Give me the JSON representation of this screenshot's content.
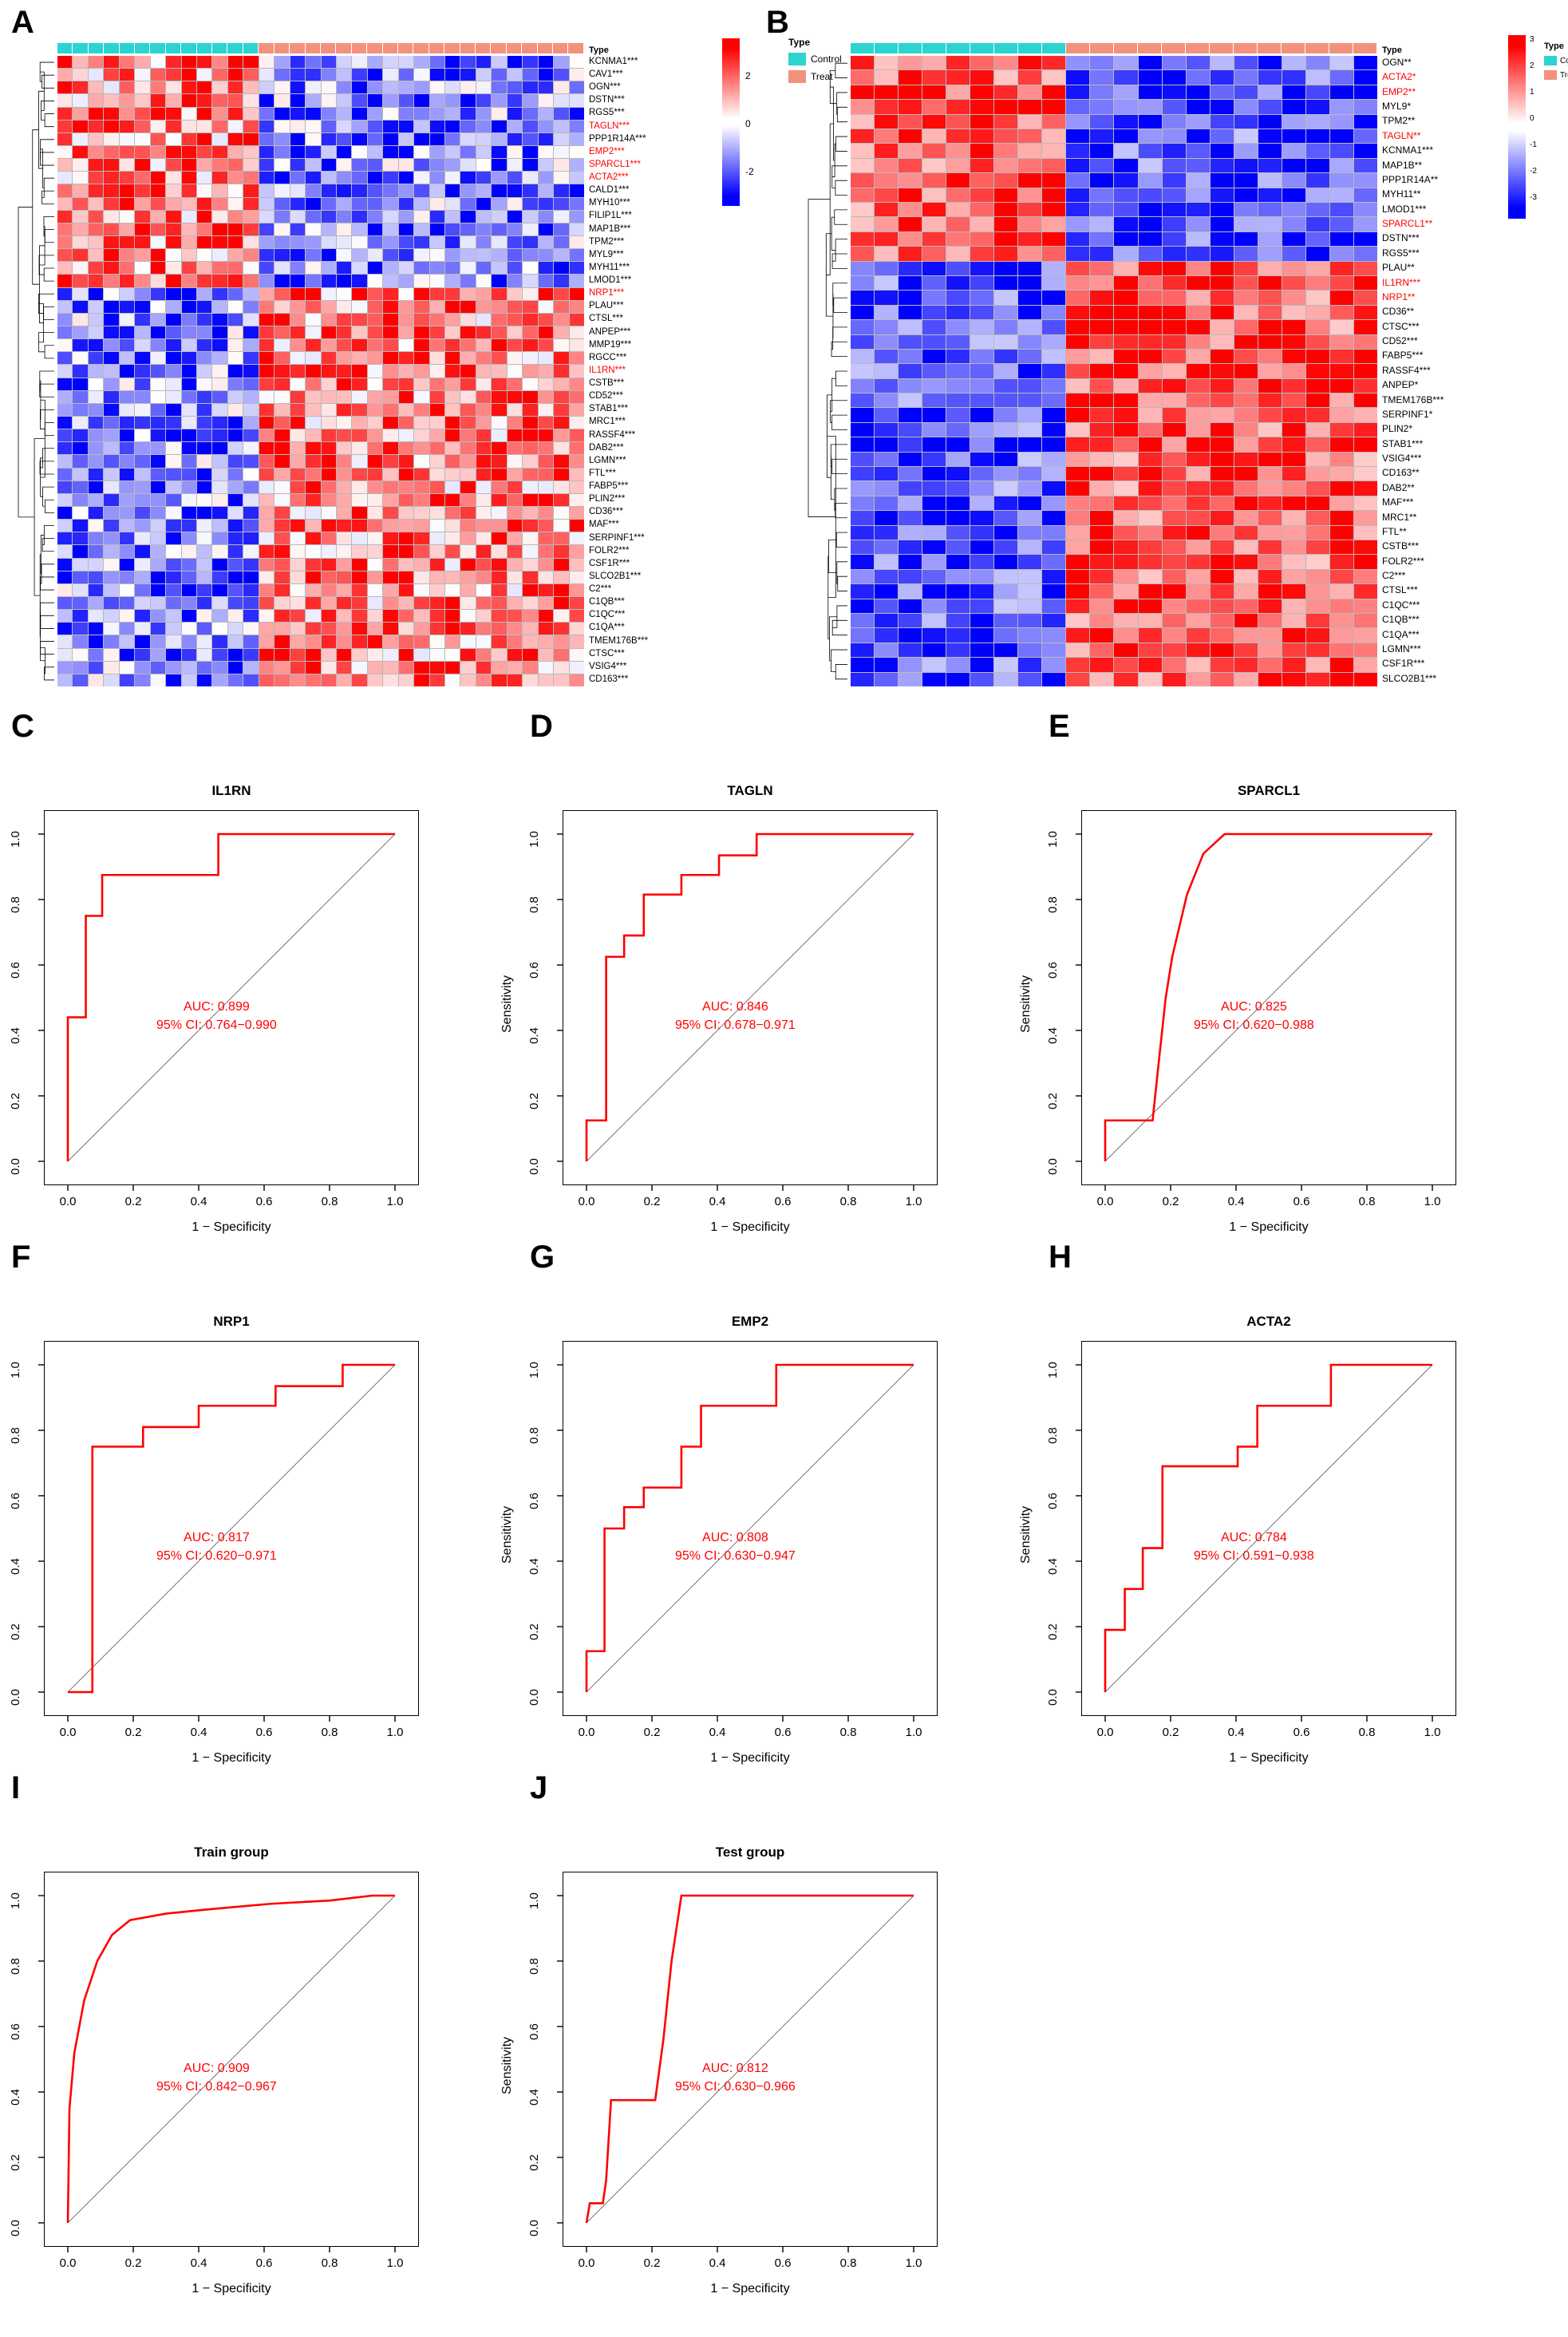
{
  "figure": {
    "panels": [
      "A",
      "B",
      "C",
      "D",
      "E",
      "F",
      "G",
      "H",
      "I",
      "J"
    ]
  },
  "heatmap_legend": {
    "type_title": "Type",
    "groups": [
      {
        "label": "Control",
        "color": "#2BD4CE"
      },
      {
        "label": "Treat",
        "color": "#F2917E"
      }
    ]
  },
  "panelA": {
    "letter": "A",
    "colorbar_ticks": [
      "2",
      "0",
      "-2"
    ],
    "annotation_title": "Type",
    "n_control": 13,
    "n_treat": 21,
    "genes": [
      {
        "label": "KCNMA1***",
        "color": "black"
      },
      {
        "label": "CAV1***",
        "color": "black"
      },
      {
        "label": "OGN***",
        "color": "black"
      },
      {
        "label": "DSTN***",
        "color": "black"
      },
      {
        "label": "RGS5***",
        "color": "black"
      },
      {
        "label": "TAGLN***",
        "color": "red"
      },
      {
        "label": "PPP1R14A***",
        "color": "black"
      },
      {
        "label": "EMP2***",
        "color": "red"
      },
      {
        "label": "SPARCL1***",
        "color": "red"
      },
      {
        "label": "ACTA2***",
        "color": "red"
      },
      {
        "label": "CALD1***",
        "color": "black"
      },
      {
        "label": "MYH10***",
        "color": "black"
      },
      {
        "label": "FILIP1L***",
        "color": "black"
      },
      {
        "label": "MAP1B***",
        "color": "black"
      },
      {
        "label": "TPM2***",
        "color": "black"
      },
      {
        "label": "MYL9***",
        "color": "black"
      },
      {
        "label": "MYH11***",
        "color": "black"
      },
      {
        "label": "LMOD1***",
        "color": "black"
      },
      {
        "label": "NRP1***",
        "color": "red"
      },
      {
        "label": "PLAU***",
        "color": "black"
      },
      {
        "label": "CTSL***",
        "color": "black"
      },
      {
        "label": "ANPEP***",
        "color": "black"
      },
      {
        "label": "MMP19***",
        "color": "black"
      },
      {
        "label": "RGCC***",
        "color": "black"
      },
      {
        "label": "IL1RN***",
        "color": "red"
      },
      {
        "label": "CSTB***",
        "color": "black"
      },
      {
        "label": "CD52***",
        "color": "black"
      },
      {
        "label": "STAB1***",
        "color": "black"
      },
      {
        "label": "MRC1***",
        "color": "black"
      },
      {
        "label": "RASSF4***",
        "color": "black"
      },
      {
        "label": "DAB2***",
        "color": "black"
      },
      {
        "label": "LGMN***",
        "color": "black"
      },
      {
        "label": "FTL***",
        "color": "black"
      },
      {
        "label": "FABP5***",
        "color": "black"
      },
      {
        "label": "PLIN2***",
        "color": "black"
      },
      {
        "label": "CD36***",
        "color": "black"
      },
      {
        "label": "MAF***",
        "color": "black"
      },
      {
        "label": "SERPINF1***",
        "color": "black"
      },
      {
        "label": "FOLR2***",
        "color": "black"
      },
      {
        "label": "CSF1R***",
        "color": "black"
      },
      {
        "label": "SLCO2B1***",
        "color": "black"
      },
      {
        "label": "C2***",
        "color": "black"
      },
      {
        "label": "C1QB***",
        "color": "black"
      },
      {
        "label": "C1QC***",
        "color": "black"
      },
      {
        "label": "C1QA***",
        "color": "black"
      },
      {
        "label": "TMEM176B***",
        "color": "black"
      },
      {
        "label": "CTSC***",
        "color": "black"
      },
      {
        "label": "VSIG4***",
        "color": "black"
      },
      {
        "label": "CD163***",
        "color": "black"
      }
    ]
  },
  "panelB": {
    "letter": "B",
    "colorbar_ticks": [
      "3",
      "2",
      "1",
      "0",
      "-1",
      "-2",
      "-3"
    ],
    "annotation_title": "Type",
    "n_control": 9,
    "n_treat": 13,
    "genes": [
      {
        "label": "OGN**",
        "color": "black"
      },
      {
        "label": "ACTA2*",
        "color": "red"
      },
      {
        "label": "EMP2**",
        "color": "red"
      },
      {
        "label": "MYL9*",
        "color": "black"
      },
      {
        "label": "TPM2**",
        "color": "black"
      },
      {
        "label": "TAGLN**",
        "color": "red"
      },
      {
        "label": "KCNMA1***",
        "color": "black"
      },
      {
        "label": "MAP1B**",
        "color": "black"
      },
      {
        "label": "PPP1R14A**",
        "color": "black"
      },
      {
        "label": "MYH11**",
        "color": "black"
      },
      {
        "label": "LMOD1***",
        "color": "black"
      },
      {
        "label": "SPARCL1**",
        "color": "red"
      },
      {
        "label": "DSTN***",
        "color": "black"
      },
      {
        "label": "RGS5***",
        "color": "black"
      },
      {
        "label": "PLAU**",
        "color": "black"
      },
      {
        "label": "IL1RN***",
        "color": "red"
      },
      {
        "label": "NRP1**",
        "color": "red"
      },
      {
        "label": "CD36**",
        "color": "black"
      },
      {
        "label": "CTSC***",
        "color": "black"
      },
      {
        "label": "CD52***",
        "color": "black"
      },
      {
        "label": "FABP5***",
        "color": "black"
      },
      {
        "label": "RASSF4***",
        "color": "black"
      },
      {
        "label": "ANPEP*",
        "color": "black"
      },
      {
        "label": "TMEM176B***",
        "color": "black"
      },
      {
        "label": "SERPINF1*",
        "color": "black"
      },
      {
        "label": "PLIN2*",
        "color": "black"
      },
      {
        "label": "STAB1***",
        "color": "black"
      },
      {
        "label": "VSIG4***",
        "color": "black"
      },
      {
        "label": "CD163**",
        "color": "black"
      },
      {
        "label": "DAB2**",
        "color": "black"
      },
      {
        "label": "MAF***",
        "color": "black"
      },
      {
        "label": "MRC1**",
        "color": "black"
      },
      {
        "label": "FTL**",
        "color": "black"
      },
      {
        "label": "CSTB***",
        "color": "black"
      },
      {
        "label": "FOLR2***",
        "color": "black"
      },
      {
        "label": "C2***",
        "color": "black"
      },
      {
        "label": "CTSL***",
        "color": "black"
      },
      {
        "label": "C1QC***",
        "color": "black"
      },
      {
        "label": "C1QB***",
        "color": "black"
      },
      {
        "label": "C1QA***",
        "color": "black"
      },
      {
        "label": "LGMN***",
        "color": "black"
      },
      {
        "label": "CSF1R***",
        "color": "black"
      },
      {
        "label": "SLCO2B1***",
        "color": "black"
      }
    ]
  },
  "roc_axis": {
    "xlabel": "1 − Specificity",
    "ylabel": "Sensitivity",
    "ticks": [
      "0.0",
      "0.2",
      "0.4",
      "0.6",
      "0.8",
      "1.0"
    ],
    "curve_color": "#FF0000",
    "diagonal_color": "#777777"
  },
  "chart_data": [
    {
      "panel": "C",
      "type": "line",
      "title": "IL1RN",
      "auc_label": "AUC: 0.899",
      "ci_label": "95% CI: 0.764−0.990",
      "auc": 0.899,
      "ci": [
        0.764,
        0.99
      ],
      "xlabel": "1 − Specificity",
      "ylabel": "Sensitivity",
      "xlim": [
        0,
        1
      ],
      "ylim": [
        0,
        1
      ],
      "grid": false,
      "points": [
        [
          0,
          0
        ],
        [
          0,
          0.44
        ],
        [
          0.055,
          0.44
        ],
        [
          0.055,
          0.75
        ],
        [
          0.105,
          0.75
        ],
        [
          0.105,
          0.875
        ],
        [
          0.46,
          0.875
        ],
        [
          0.46,
          1.0
        ],
        [
          1,
          1
        ]
      ]
    },
    {
      "panel": "D",
      "type": "line",
      "title": "TAGLN",
      "auc_label": "AUC: 0.846",
      "ci_label": "95% CI: 0.678−0.971",
      "auc": 0.846,
      "ci": [
        0.678,
        0.971
      ],
      "xlabel": "1 − Specificity",
      "ylabel": "Sensitivity",
      "xlim": [
        0,
        1
      ],
      "ylim": [
        0,
        1
      ],
      "grid": false,
      "points": [
        [
          0,
          0
        ],
        [
          0,
          0.125
        ],
        [
          0.06,
          0.125
        ],
        [
          0.06,
          0.625
        ],
        [
          0.115,
          0.625
        ],
        [
          0.115,
          0.69
        ],
        [
          0.175,
          0.69
        ],
        [
          0.175,
          0.815
        ],
        [
          0.29,
          0.815
        ],
        [
          0.29,
          0.875
        ],
        [
          0.405,
          0.875
        ],
        [
          0.405,
          0.935
        ],
        [
          0.52,
          0.935
        ],
        [
          0.52,
          1.0
        ],
        [
          1,
          1
        ]
      ]
    },
    {
      "panel": "E",
      "type": "line",
      "title": "SPARCL1",
      "auc_label": "AUC: 0.825",
      "ci_label": "95% CI: 0.620−0.988",
      "auc": 0.825,
      "ci": [
        0.62,
        0.988
      ],
      "xlabel": "1 − Specificity",
      "ylabel": "Sensitivity",
      "xlim": [
        0,
        1
      ],
      "ylim": [
        0,
        1
      ],
      "grid": false,
      "points": [
        [
          0,
          0
        ],
        [
          0,
          0.125
        ],
        [
          0.145,
          0.125
        ],
        [
          0.165,
          0.315
        ],
        [
          0.185,
          0.5
        ],
        [
          0.205,
          0.625
        ],
        [
          0.25,
          0.815
        ],
        [
          0.3,
          0.94
        ],
        [
          0.365,
          1.0
        ],
        [
          1,
          1
        ]
      ]
    },
    {
      "panel": "F",
      "type": "line",
      "title": "NRP1",
      "auc_label": "AUC: 0.817",
      "ci_label": "95% CI: 0.620−0.971",
      "auc": 0.817,
      "ci": [
        0.62,
        0.971
      ],
      "xlabel": "1 − Specificity",
      "ylabel": "Sensitivity",
      "xlim": [
        0,
        1
      ],
      "ylim": [
        0,
        1
      ],
      "grid": false,
      "points": [
        [
          0,
          0
        ],
        [
          0.075,
          0
        ],
        [
          0.075,
          0.75
        ],
        [
          0.23,
          0.75
        ],
        [
          0.23,
          0.81
        ],
        [
          0.4,
          0.81
        ],
        [
          0.4,
          0.875
        ],
        [
          0.635,
          0.875
        ],
        [
          0.635,
          0.935
        ],
        [
          0.84,
          0.935
        ],
        [
          0.84,
          1.0
        ],
        [
          1,
          1
        ]
      ]
    },
    {
      "panel": "G",
      "type": "line",
      "title": "EMP2",
      "auc_label": "AUC: 0.808",
      "ci_label": "95% CI: 0.630−0.947",
      "auc": 0.808,
      "ci": [
        0.63,
        0.947
      ],
      "xlabel": "1 − Specificity",
      "ylabel": "Sensitivity",
      "xlim": [
        0,
        1
      ],
      "ylim": [
        0,
        1
      ],
      "grid": false,
      "points": [
        [
          0,
          0
        ],
        [
          0,
          0.125
        ],
        [
          0.055,
          0.125
        ],
        [
          0.055,
          0.5
        ],
        [
          0.115,
          0.5
        ],
        [
          0.115,
          0.565
        ],
        [
          0.175,
          0.565
        ],
        [
          0.175,
          0.625
        ],
        [
          0.29,
          0.625
        ],
        [
          0.29,
          0.75
        ],
        [
          0.35,
          0.75
        ],
        [
          0.35,
          0.875
        ],
        [
          0.58,
          0.875
        ],
        [
          0.58,
          1.0
        ],
        [
          1,
          1
        ]
      ]
    },
    {
      "panel": "H",
      "type": "line",
      "title": "ACTA2",
      "auc_label": "AUC: 0.784",
      "ci_label": "95% CI: 0.591−0.938",
      "auc": 0.784,
      "ci": [
        0.591,
        0.938
      ],
      "xlabel": "1 − Specificity",
      "ylabel": "Sensitivity",
      "xlim": [
        0,
        1
      ],
      "ylim": [
        0,
        1
      ],
      "grid": false,
      "points": [
        [
          0,
          0
        ],
        [
          0,
          0.19
        ],
        [
          0.06,
          0.19
        ],
        [
          0.06,
          0.315
        ],
        [
          0.115,
          0.315
        ],
        [
          0.115,
          0.44
        ],
        [
          0.175,
          0.44
        ],
        [
          0.175,
          0.69
        ],
        [
          0.405,
          0.69
        ],
        [
          0.405,
          0.75
        ],
        [
          0.465,
          0.75
        ],
        [
          0.465,
          0.875
        ],
        [
          0.69,
          0.875
        ],
        [
          0.69,
          1.0
        ],
        [
          1,
          1
        ]
      ]
    },
    {
      "panel": "I",
      "type": "line",
      "title": "Train group",
      "auc_label": "AUC: 0.909",
      "ci_label": "95% CI: 0.842−0.967",
      "auc": 0.909,
      "ci": [
        0.842,
        0.967
      ],
      "xlabel": "1 − Specificity",
      "ylabel": "Sensitivity",
      "xlim": [
        0,
        1
      ],
      "ylim": [
        0,
        1
      ],
      "grid": false,
      "points": [
        [
          0,
          0
        ],
        [
          0.005,
          0.35
        ],
        [
          0.02,
          0.52
        ],
        [
          0.05,
          0.68
        ],
        [
          0.09,
          0.8
        ],
        [
          0.135,
          0.88
        ],
        [
          0.19,
          0.925
        ],
        [
          0.3,
          0.945
        ],
        [
          0.45,
          0.96
        ],
        [
          0.62,
          0.975
        ],
        [
          0.8,
          0.985
        ],
        [
          0.93,
          1.0
        ],
        [
          1,
          1
        ]
      ]
    },
    {
      "panel": "J",
      "type": "line",
      "title": "Test group",
      "auc_label": "AUC: 0.812",
      "ci_label": "95% CI: 0.630−0.966",
      "auc": 0.812,
      "ci": [
        0.63,
        0.966
      ],
      "xlabel": "1 − Specificity",
      "ylabel": "Sensitivity",
      "xlim": [
        0,
        1
      ],
      "ylim": [
        0,
        1
      ],
      "grid": false,
      "points": [
        [
          0,
          0
        ],
        [
          0.01,
          0.06
        ],
        [
          0.05,
          0.06
        ],
        [
          0.06,
          0.13
        ],
        [
          0.075,
          0.375
        ],
        [
          0.21,
          0.375
        ],
        [
          0.235,
          0.56
        ],
        [
          0.26,
          0.8
        ],
        [
          0.29,
          1.0
        ],
        [
          1,
          1
        ]
      ]
    }
  ]
}
